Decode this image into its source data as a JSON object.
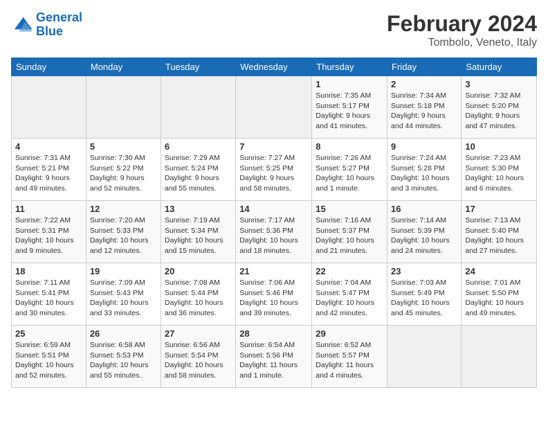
{
  "header": {
    "logo_line1": "General",
    "logo_line2": "Blue",
    "month_year": "February 2024",
    "location": "Tombolo, Veneto, Italy"
  },
  "weekdays": [
    "Sunday",
    "Monday",
    "Tuesday",
    "Wednesday",
    "Thursday",
    "Friday",
    "Saturday"
  ],
  "weeks": [
    [
      {
        "day": "",
        "info": ""
      },
      {
        "day": "",
        "info": ""
      },
      {
        "day": "",
        "info": ""
      },
      {
        "day": "",
        "info": ""
      },
      {
        "day": "1",
        "info": "Sunrise: 7:35 AM\nSunset: 5:17 PM\nDaylight: 9 hours\nand 41 minutes."
      },
      {
        "day": "2",
        "info": "Sunrise: 7:34 AM\nSunset: 5:18 PM\nDaylight: 9 hours\nand 44 minutes."
      },
      {
        "day": "3",
        "info": "Sunrise: 7:32 AM\nSunset: 5:20 PM\nDaylight: 9 hours\nand 47 minutes."
      }
    ],
    [
      {
        "day": "4",
        "info": "Sunrise: 7:31 AM\nSunset: 5:21 PM\nDaylight: 9 hours\nand 49 minutes."
      },
      {
        "day": "5",
        "info": "Sunrise: 7:30 AM\nSunset: 5:22 PM\nDaylight: 9 hours\nand 52 minutes."
      },
      {
        "day": "6",
        "info": "Sunrise: 7:29 AM\nSunset: 5:24 PM\nDaylight: 9 hours\nand 55 minutes."
      },
      {
        "day": "7",
        "info": "Sunrise: 7:27 AM\nSunset: 5:25 PM\nDaylight: 9 hours\nand 58 minutes."
      },
      {
        "day": "8",
        "info": "Sunrise: 7:26 AM\nSunset: 5:27 PM\nDaylight: 10 hours\nand 1 minute."
      },
      {
        "day": "9",
        "info": "Sunrise: 7:24 AM\nSunset: 5:28 PM\nDaylight: 10 hours\nand 3 minutes."
      },
      {
        "day": "10",
        "info": "Sunrise: 7:23 AM\nSunset: 5:30 PM\nDaylight: 10 hours\nand 6 minutes."
      }
    ],
    [
      {
        "day": "11",
        "info": "Sunrise: 7:22 AM\nSunset: 5:31 PM\nDaylight: 10 hours\nand 9 minutes."
      },
      {
        "day": "12",
        "info": "Sunrise: 7:20 AM\nSunset: 5:33 PM\nDaylight: 10 hours\nand 12 minutes."
      },
      {
        "day": "13",
        "info": "Sunrise: 7:19 AM\nSunset: 5:34 PM\nDaylight: 10 hours\nand 15 minutes."
      },
      {
        "day": "14",
        "info": "Sunrise: 7:17 AM\nSunset: 5:36 PM\nDaylight: 10 hours\nand 18 minutes."
      },
      {
        "day": "15",
        "info": "Sunrise: 7:16 AM\nSunset: 5:37 PM\nDaylight: 10 hours\nand 21 minutes."
      },
      {
        "day": "16",
        "info": "Sunrise: 7:14 AM\nSunset: 5:39 PM\nDaylight: 10 hours\nand 24 minutes."
      },
      {
        "day": "17",
        "info": "Sunrise: 7:13 AM\nSunset: 5:40 PM\nDaylight: 10 hours\nand 27 minutes."
      }
    ],
    [
      {
        "day": "18",
        "info": "Sunrise: 7:11 AM\nSunset: 5:41 PM\nDaylight: 10 hours\nand 30 minutes."
      },
      {
        "day": "19",
        "info": "Sunrise: 7:09 AM\nSunset: 5:43 PM\nDaylight: 10 hours\nand 33 minutes."
      },
      {
        "day": "20",
        "info": "Sunrise: 7:08 AM\nSunset: 5:44 PM\nDaylight: 10 hours\nand 36 minutes."
      },
      {
        "day": "21",
        "info": "Sunrise: 7:06 AM\nSunset: 5:46 PM\nDaylight: 10 hours\nand 39 minutes."
      },
      {
        "day": "22",
        "info": "Sunrise: 7:04 AM\nSunset: 5:47 PM\nDaylight: 10 hours\nand 42 minutes."
      },
      {
        "day": "23",
        "info": "Sunrise: 7:03 AM\nSunset: 5:49 PM\nDaylight: 10 hours\nand 45 minutes."
      },
      {
        "day": "24",
        "info": "Sunrise: 7:01 AM\nSunset: 5:50 PM\nDaylight: 10 hours\nand 49 minutes."
      }
    ],
    [
      {
        "day": "25",
        "info": "Sunrise: 6:59 AM\nSunset: 5:51 PM\nDaylight: 10 hours\nand 52 minutes."
      },
      {
        "day": "26",
        "info": "Sunrise: 6:58 AM\nSunset: 5:53 PM\nDaylight: 10 hours\nand 55 minutes."
      },
      {
        "day": "27",
        "info": "Sunrise: 6:56 AM\nSunset: 5:54 PM\nDaylight: 10 hours\nand 58 minutes."
      },
      {
        "day": "28",
        "info": "Sunrise: 6:54 AM\nSunset: 5:56 PM\nDaylight: 11 hours\nand 1 minute."
      },
      {
        "day": "29",
        "info": "Sunrise: 6:52 AM\nSunset: 5:57 PM\nDaylight: 11 hours\nand 4 minutes."
      },
      {
        "day": "",
        "info": ""
      },
      {
        "day": "",
        "info": ""
      }
    ]
  ]
}
